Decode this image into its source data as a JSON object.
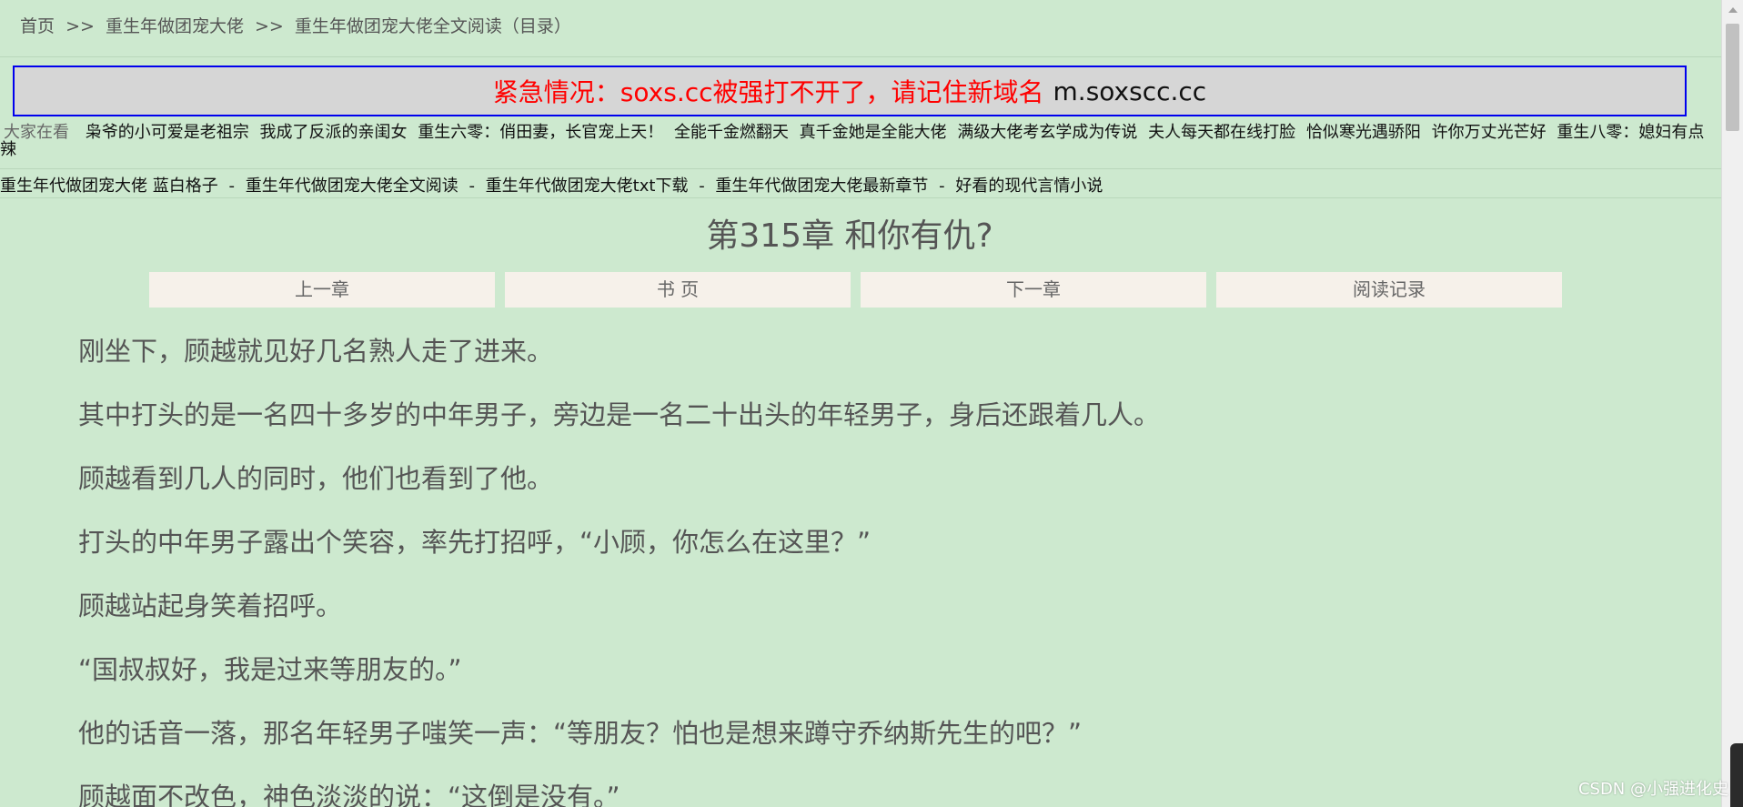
{
  "breadcrumb": {
    "home": "首页",
    "sep": ">>",
    "book": "重生年做团宠大佬",
    "current": "重生年做团宠大佬全文阅读（目录）"
  },
  "notice": {
    "text": "紧急情况：soxs.cc被强打不开了，请记住新域名",
    "domain": "m.soxscc.cc"
  },
  "hot": {
    "label": "大家在看",
    "items": [
      "枭爷的小可爱是老祖宗",
      "我成了反派的亲闺女",
      "重生六零：俏田妻，长官宠上天！",
      "全能千金燃翻天",
      "真千金她是全能大佬",
      "满级大佬考玄学成为传说",
      "夫人每天都在线打脸",
      "恰似寒光遇骄阳",
      "许你万丈光芒好",
      "重生八零：媳妇有点辣"
    ]
  },
  "seo": {
    "book_author": "重生年代做团宠大佬 蓝白格子",
    "read": "重生年代做团宠大佬全文阅读",
    "download": "重生年代做团宠大佬txt下载",
    "latest": "重生年代做团宠大佬最新章节",
    "category": "好看的现代言情小说",
    "dash": "-"
  },
  "chapter": {
    "title": "第315章 和你有仇?"
  },
  "nav": {
    "prev": "上一章",
    "index": "书 页",
    "next": "下一章",
    "history": "阅读记录"
  },
  "content": {
    "paragraphs": [
      "刚坐下，顾越就见好几名熟人走了进来。",
      "其中打头的是一名四十多岁的中年男子，旁边是一名二十出头的年轻男子，身后还跟着几人。",
      "顾越看到几人的同时，他们也看到了他。",
      "打头的中年男子露出个笑容，率先打招呼，“小顾，你怎么在这里？”",
      "顾越站起身笑着招呼。",
      "“国叔叔好，我是过来等朋友的。”",
      "他的话音一落，那名年轻男子嗤笑一声：“等朋友？怕也是想来蹲守乔纳斯先生的吧？”",
      "顾越面不改色，神色淡淡的说：“这倒是没有。”"
    ]
  },
  "watermark": "CSDN @小强进化史",
  "colors": {
    "background": "#cde9cf",
    "notice_red": "#ff0000",
    "notice_border": "#0000ee",
    "nav_button": "#f6f1ea"
  }
}
